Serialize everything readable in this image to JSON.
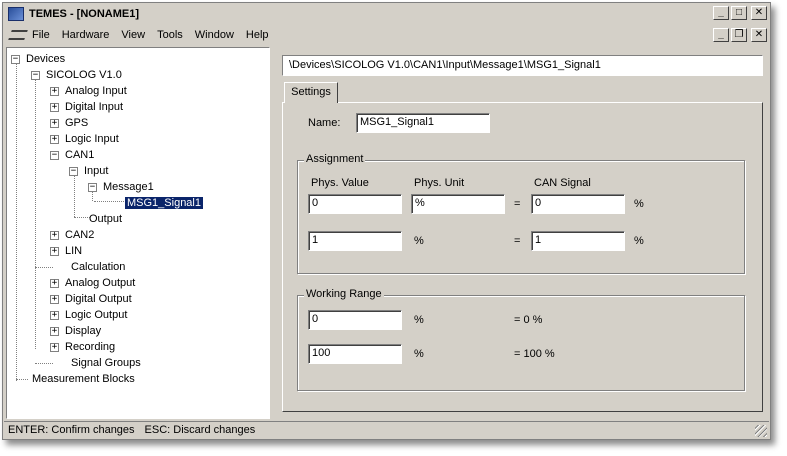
{
  "window": {
    "title": "TEMES - [NONAME1]"
  },
  "caption_buttons": {
    "minimize": "_",
    "maximize": "□",
    "close": "✕"
  },
  "mdi_buttons": {
    "minimize": "_",
    "restore": "❐",
    "close": "✕"
  },
  "menu": [
    "File",
    "Hardware",
    "View",
    "Tools",
    "Window",
    "Help"
  ],
  "tree": {
    "devices": "Devices",
    "sicolog": "SICOLOG V1.0",
    "analog_input": "Analog Input",
    "digital_input": "Digital Input",
    "gps": "GPS",
    "logic_input": "Logic Input",
    "can1": "CAN1",
    "input": "Input",
    "message1": "Message1",
    "msg1_signal1": "MSG1_Signal1",
    "output": "Output",
    "can2": "CAN2",
    "lin": "LIN",
    "calculation": "Calculation",
    "analog_output": "Analog Output",
    "digital_output": "Digital Output",
    "logic_output": "Logic Output",
    "display": "Display",
    "recording": "Recording",
    "signal_groups": "Signal Groups",
    "measurement_blocks": "Measurement Blocks",
    "expand_plus": "+",
    "expand_minus": "−"
  },
  "path": "\\Devices\\SICOLOG V1.0\\CAN1\\Input\\Message1\\MSG1_Signal1",
  "tabs": {
    "settings": "Settings"
  },
  "form": {
    "name_label": "Name:",
    "name_value": "MSG1_Signal1",
    "assignment": {
      "title": "Assignment",
      "phys_value_header": "Phys. Value",
      "phys_unit_header": "Phys. Unit",
      "can_signal_header": "CAN Signal",
      "row1": {
        "phys_value": "0",
        "phys_unit": "%",
        "eq": "=",
        "can_signal": "0",
        "unit": "%"
      },
      "row2": {
        "phys_value": "1",
        "unit_text": "%",
        "eq": "=",
        "can_signal": "1",
        "unit": "%"
      }
    },
    "working_range": {
      "title": "Working Range",
      "row1": {
        "value": "0",
        "unit": "%",
        "result": "= 0 %"
      },
      "row2": {
        "value": "100",
        "unit": "%",
        "result": "= 100 %"
      }
    }
  },
  "status": {
    "enter": "ENTER: Confirm changes",
    "esc": "ESC: Discard changes"
  }
}
